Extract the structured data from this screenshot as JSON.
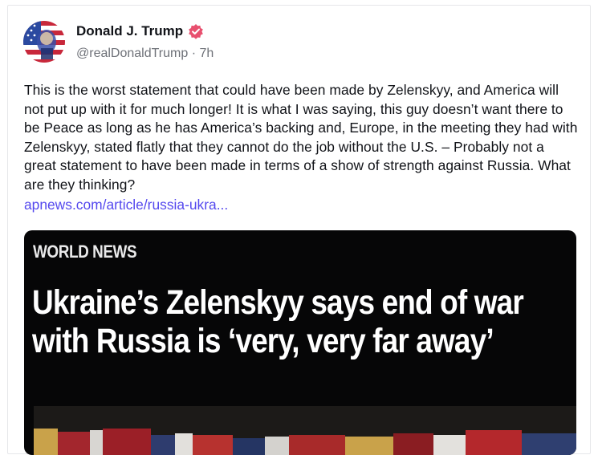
{
  "author": {
    "name": "Donald J. Trump",
    "handle": "@realDonaldTrump",
    "separator": "·",
    "time": "7h",
    "verified_color": "#e8506f",
    "avatar_icon": "flag-portrait-avatar"
  },
  "post": {
    "text": "This is the worst statement that could have been made by Zelenskyy, and America will not put up with it for much longer! It is what I was saying, this guy doesn’t want there to be Peace as long as he has America’s backing and, Europe, in the meeting they had with Zelenskyy, stated flatly that they cannot do the job without the U.S. – Probably not a great statement to have been made in terms of a show of strength against Russia. What are they thinking?",
    "link_text": "apnews.com/article/russia-ukra...",
    "link_color": "#5448ee"
  },
  "link_card": {
    "kicker": "WORLD NEWS",
    "headline": "Ukraine’s Zelenskyy says end of war with Russia is ‘very, very far away’",
    "background": "#060607"
  }
}
